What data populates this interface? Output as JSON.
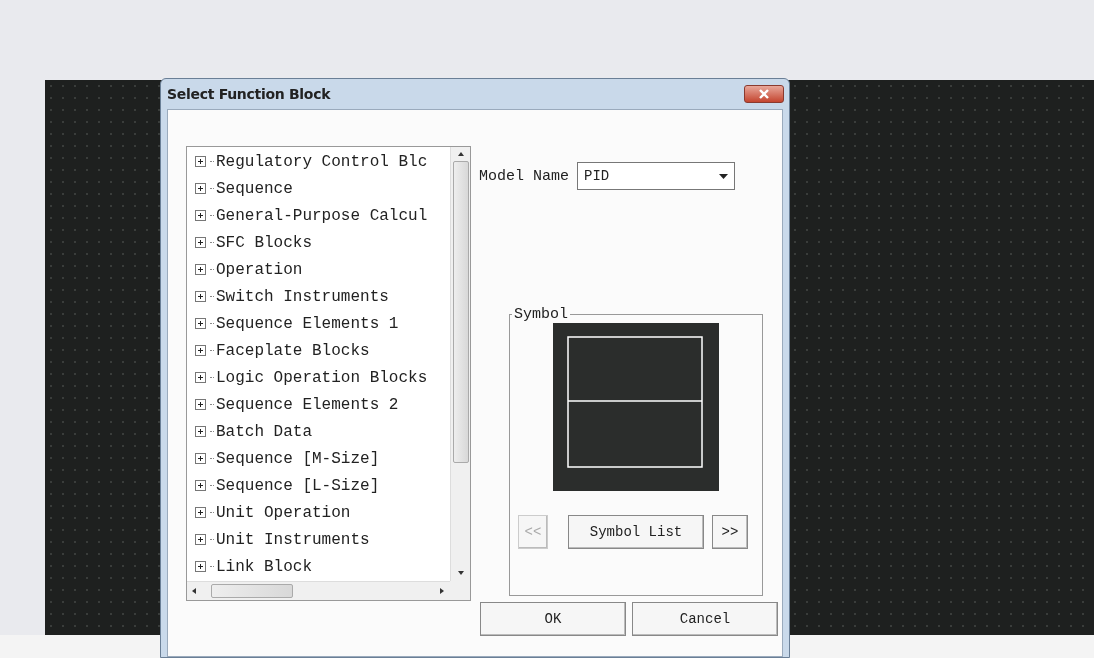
{
  "dialog": {
    "title": "Select Function Block",
    "tree": [
      {
        "label": "Regulatory Control Blc",
        "expanded": false
      },
      {
        "label": "Sequence",
        "expanded": false
      },
      {
        "label": "General-Purpose Calcul",
        "expanded": false
      },
      {
        "label": "SFC Blocks",
        "expanded": false
      },
      {
        "label": "Operation",
        "expanded": false
      },
      {
        "label": "Switch Instruments",
        "expanded": false
      },
      {
        "label": "Sequence Elements 1",
        "expanded": false
      },
      {
        "label": "Faceplate Blocks",
        "expanded": false
      },
      {
        "label": "Logic Operation Blocks",
        "expanded": false
      },
      {
        "label": "Sequence Elements 2",
        "expanded": false
      },
      {
        "label": "Batch Data",
        "expanded": false
      },
      {
        "label": "Sequence [M-Size]",
        "expanded": false
      },
      {
        "label": "Sequence [L-Size]",
        "expanded": false
      },
      {
        "label": "Unit Operation",
        "expanded": false
      },
      {
        "label": "Unit Instruments",
        "expanded": false
      },
      {
        "label": "Link Block",
        "expanded": false
      }
    ],
    "model_name": {
      "label": "Model Name",
      "value": "PID"
    },
    "symbol": {
      "label": "Symbol",
      "buttons": [
        {
          "label": "<<",
          "disabled": true
        },
        {
          "label": "Symbol List",
          "disabled": false
        },
        {
          "label": ">>",
          "disabled": false
        }
      ]
    },
    "buttons": [
      "OK",
      "Cancel"
    ]
  }
}
